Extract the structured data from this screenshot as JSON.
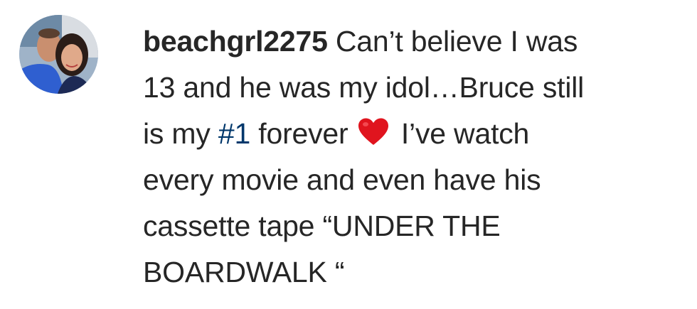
{
  "comment": {
    "username": "beachgrl2275",
    "lines": [
      {
        "before": " Can’t believe I was"
      },
      {
        "before": "13 and he was my idol…Bruce still"
      },
      {
        "before": "is my ",
        "hashtag": "#1",
        "after": " forever ",
        "emoji": "red-heart",
        "after2": " I’ve watch"
      },
      {
        "before": "every movie and even have his"
      },
      {
        "before": "cassette tape “UNDER THE"
      },
      {
        "before": "BOARDWALK “"
      }
    ]
  },
  "colors": {
    "text": "#262626",
    "hashtag": "#00376b",
    "heart": "#e0141e"
  },
  "icons": {
    "avatar": "user-profile-photo",
    "heart": "red-heart-emoji"
  }
}
